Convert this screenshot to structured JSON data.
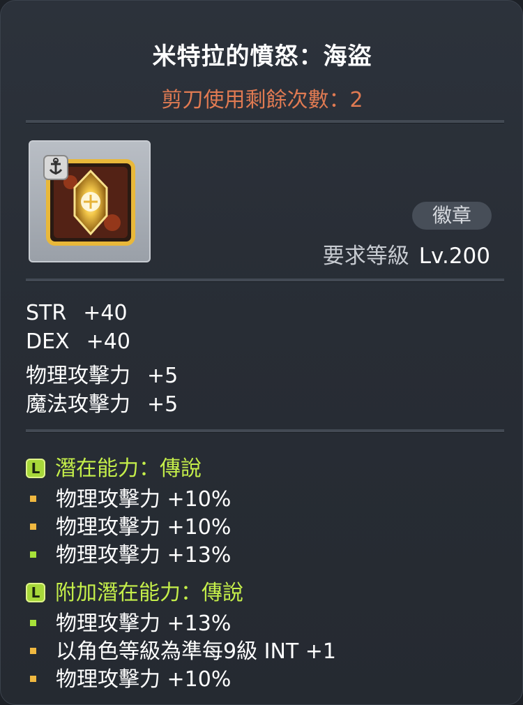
{
  "item": {
    "name": "米特拉的憤怒：海盜",
    "scissors_text": "剪刀使用剩餘次數：2",
    "type_badge": "徽章",
    "required_level_label": "要求等級",
    "required_level_value": "Lv.200",
    "icon_name": "emblem-anchor-icon"
  },
  "stats": [
    {
      "label": "STR",
      "value": "+40"
    },
    {
      "label": "DEX",
      "value": "+40"
    },
    {
      "label": "物理攻擊力",
      "value": "+5"
    },
    {
      "label": "魔法攻擊力",
      "value": "+5"
    }
  ],
  "potential": {
    "grade_letter": "L",
    "header": "潛在能力：傳說",
    "lines": [
      {
        "text": "物理攻擊力 +10%",
        "tier_color": "#f0b840"
      },
      {
        "text": "物理攻擊力 +10%",
        "tier_color": "#f0b840"
      },
      {
        "text": "物理攻擊力 +13%",
        "tier_color": "#a8e23a"
      }
    ]
  },
  "bonus_potential": {
    "grade_letter": "L",
    "header": "附加潛在能力：傳說",
    "lines": [
      {
        "text": "物理攻擊力 +13%",
        "tier_color": "#a8e23a"
      },
      {
        "text": "以角色等級為準每9級 INT +1",
        "tier_color": "#f0b840"
      },
      {
        "text": "物理攻擊力 +10%",
        "tier_color": "#f0b840"
      }
    ]
  },
  "colors": {
    "title": "#ffffff",
    "scissors": "#e07a52",
    "potential_header": "#c5ef4a",
    "background": "#2a2f37"
  }
}
